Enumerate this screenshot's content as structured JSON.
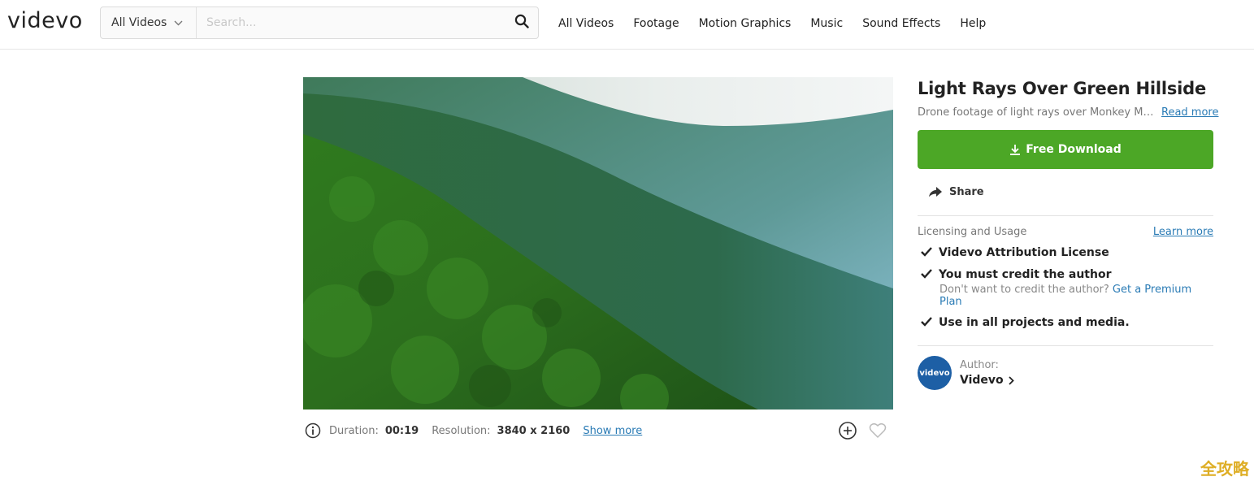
{
  "header": {
    "logo": "videvo",
    "search": {
      "category": "All Videos",
      "placeholder": "Search..."
    },
    "nav": [
      "All Videos",
      "Footage",
      "Motion Graphics",
      "Music",
      "Sound Effects",
      "Help"
    ]
  },
  "video": {
    "meta": {
      "duration_label": "Duration:",
      "duration_value": "00:19",
      "resolution_label": "Resolution:",
      "resolution_value": "3840 x 2160",
      "show_more": "Show more"
    }
  },
  "panel": {
    "title": "Light Rays Over Green Hillside",
    "description": "Drone footage of light rays over Monkey Mour...",
    "read_more": "Read more",
    "download_label": "Free Download",
    "share_label": "Share",
    "licensing": {
      "heading": "Licensing and Usage",
      "learn_more": "Learn more",
      "items": [
        "Videvo Attribution License",
        "You must credit the author",
        "Use in all projects and media."
      ],
      "sub_text": "Don't want to credit the author?",
      "premium_link": "Get a Premium Plan"
    },
    "author": {
      "label": "Author:",
      "name": "Videvo",
      "avatar_text": "videvo"
    }
  },
  "watermark": "全攻略",
  "colors": {
    "accent_green": "#4ca726",
    "link_blue": "#2a7bb5",
    "avatar_blue": "#1d5fa5"
  }
}
